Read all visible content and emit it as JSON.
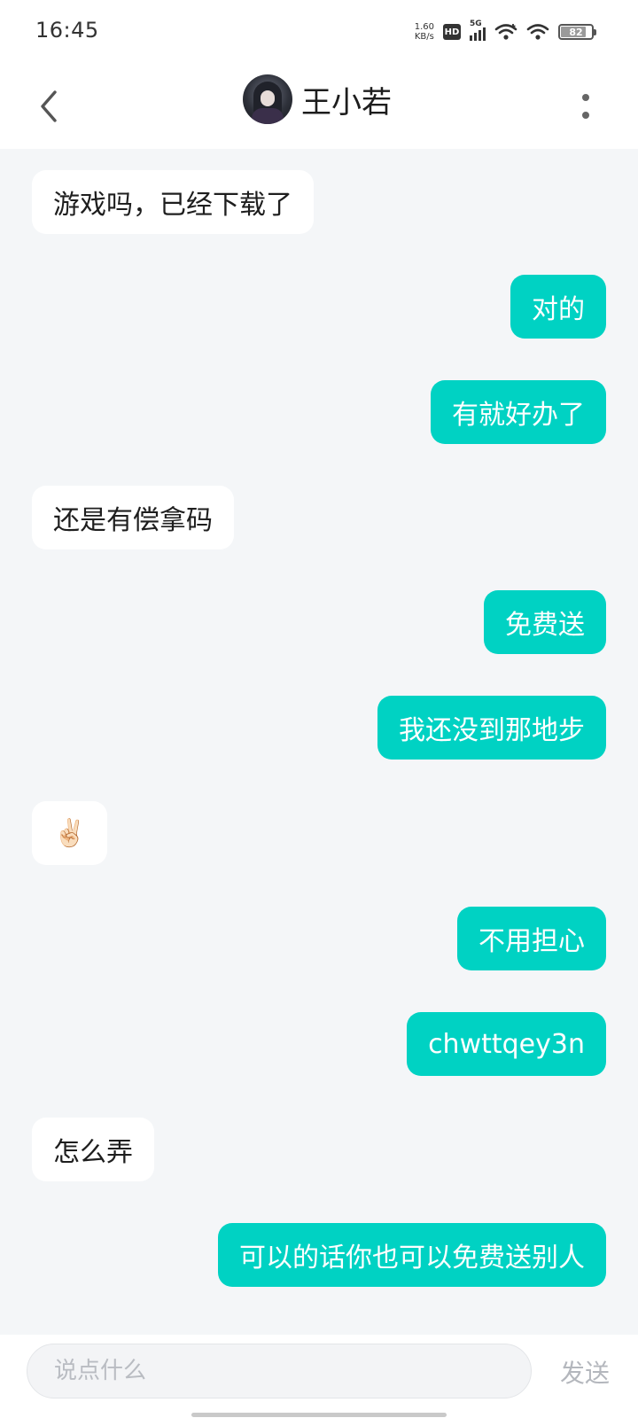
{
  "status_bar": {
    "time": "16:45",
    "net_speed_value": "1.60",
    "net_speed_unit": "KB/s",
    "hd": "HD",
    "network": "5G",
    "battery": "82",
    "battery_level": 0.82
  },
  "header": {
    "title": "王小若",
    "back_icon": "chevron-left-icon",
    "more_icon": "more-vertical-icon"
  },
  "messages": [
    {
      "direction": "received",
      "text": "游戏吗，已经下载了"
    },
    {
      "direction": "sent",
      "text": "对的"
    },
    {
      "direction": "sent",
      "text": "有就好办了"
    },
    {
      "direction": "received",
      "text": "还是有偿拿码"
    },
    {
      "direction": "sent",
      "text": "免费送"
    },
    {
      "direction": "sent",
      "text": "我还没到那地步"
    },
    {
      "direction": "received",
      "text": "✌🏻"
    },
    {
      "direction": "sent",
      "text": "不用担心"
    },
    {
      "direction": "sent",
      "text": "chwttqey3n"
    },
    {
      "direction": "received",
      "text": "怎么弄"
    },
    {
      "direction": "sent",
      "text": "可以的话你也可以免费送别人"
    }
  ],
  "input": {
    "value": "",
    "placeholder": "说点什么",
    "send_label": "发送"
  },
  "colors": {
    "sent_bubble": "#00d2c3",
    "received_bubble": "#ffffff",
    "chat_background": "#f4f6f8"
  }
}
